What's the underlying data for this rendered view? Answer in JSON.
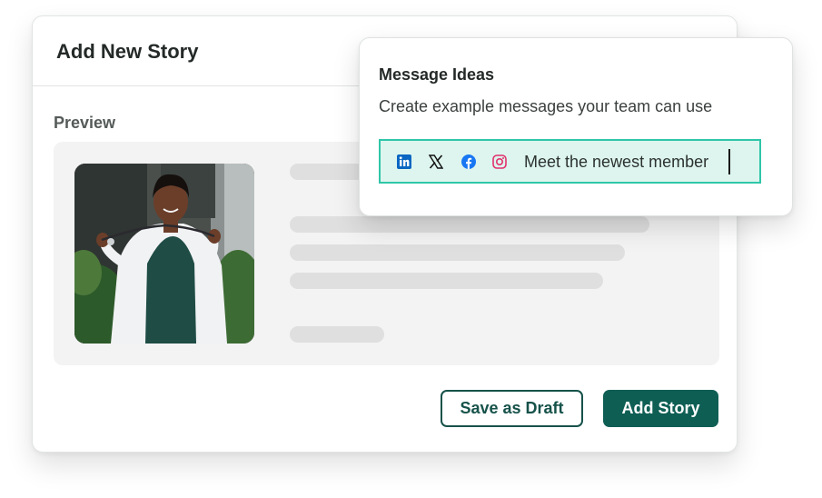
{
  "story_card": {
    "title": "Add New Story",
    "preview_label": "Preview",
    "photo_icon": "portrait-photo",
    "buttons": {
      "save_draft": "Save as Draft",
      "add_story": "Add Story"
    }
  },
  "message_ideas": {
    "title": "Message Ideas",
    "subtitle": "Create example messages your team can use",
    "input_value": "Meet the newest member",
    "social_icons": [
      "linkedin-icon",
      "x-icon",
      "facebook-icon",
      "instagram-icon"
    ]
  },
  "colors": {
    "primary": "#0e5e54",
    "accent_border": "#2fc6a8",
    "input_bg": "#ddf5ee",
    "linkedin": "#0a66c2",
    "facebook": "#1877f2",
    "instagram": "#e1306c"
  }
}
